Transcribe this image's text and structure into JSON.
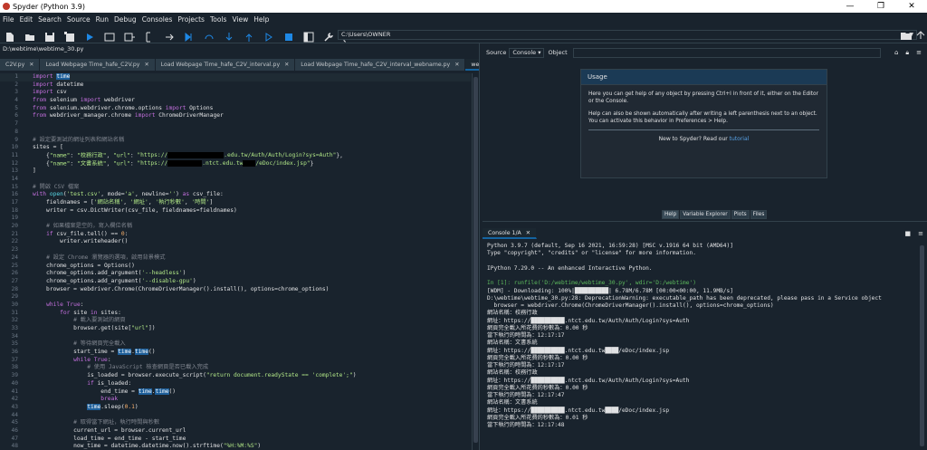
{
  "window": {
    "title": "Spyder (Python 3.9)",
    "controls": [
      "—",
      "❐",
      "✕"
    ]
  },
  "menu": [
    "File",
    "Edit",
    "Search",
    "Source",
    "Run",
    "Debug",
    "Consoles",
    "Projects",
    "Tools",
    "View",
    "Help"
  ],
  "toolbar": {
    "path": "C:\\Users\\OWNER"
  },
  "editor": {
    "filepath": "D:\\webtime\\webtime_30.py",
    "tabs": [
      {
        "label": "C2V.py",
        "active": false
      },
      {
        "label": "Load Webpage Time_hafe_C2V.py",
        "active": false
      },
      {
        "label": "Load Webpage Time_hafe_C2V_interval.py",
        "active": false
      },
      {
        "label": "Load Webpage Time_hafe_C2V_interval_webname.py",
        "active": false
      },
      {
        "label": "webtime_30.py",
        "active": true
      }
    ],
    "lines": [
      {
        "n": "1",
        "html": "<span class='k'>import</span> <span class='hl'>time</span>"
      },
      {
        "n": "2",
        "html": "<span class='k'>import</span> datetime"
      },
      {
        "n": "3",
        "html": "<span class='k'>import</span> csv"
      },
      {
        "n": "4",
        "html": "<span class='k'>from</span> selenium <span class='k'>import</span> webdriver"
      },
      {
        "n": "5",
        "html": "<span class='k'>from</span> selenium.webdriver.chrome.options <span class='k'>import</span> Options"
      },
      {
        "n": "6",
        "html": "<span class='k'>from</span> webdriver_manager.chrome <span class='k'>import</span> ChromeDriverManager"
      },
      {
        "n": "7",
        "html": ""
      },
      {
        "n": "8",
        "html": ""
      },
      {
        "n": "9",
        "html": "<span class='c'># 設定要測試的網址列表和網站名稱</span>"
      },
      {
        "n": "10",
        "html": "sites = ["
      },
      {
        "n": "11",
        "html": "    {<span class='s'>\"name\"</span>: <span class='s'>\"校務行政\"</span>, <span class='s'>\"url\"</span>: <span class='s'>\"https://<span class='redact' style='width:62px'></span>.edu.tw/Auth/Auth/Login?sys=Auth\"</span>},"
      },
      {
        "n": "12",
        "html": "    {<span class='s'>\"name\"</span>: <span class='s'>\"文書系統\"</span>, <span class='s'>\"url\"</span>: <span class='s'>\"https://<span class='redact' style='width:38px'></span>.ntct.edu.tw<span class='redact' style='width:14px'></span>/eDoc/index.jsp\"</span>}"
      },
      {
        "n": "13",
        "html": "]"
      },
      {
        "n": "14",
        "html": ""
      },
      {
        "n": "15",
        "html": "<span class='c'># 開啟 CSV 檔案</span>"
      },
      {
        "n": "16",
        "html": "<span class='k'>with</span> <span class='f'>open</span>(<span class='s'>'test.csv'</span>, mode=<span class='s'>'a'</span>, newline=<span class='s'>''</span>) <span class='k'>as</span> csv_file:"
      },
      {
        "n": "17",
        "html": "    fieldnames = [<span class='s'>'網站名稱'</span>, <span class='s'>'網址'</span>, <span class='s'>'執行秒數'</span>, <span class='s'>'時間'</span>]"
      },
      {
        "n": "18",
        "html": "    writer = csv.DictWriter(csv_file, fieldnames=fieldnames)"
      },
      {
        "n": "19",
        "html": ""
      },
      {
        "n": "20",
        "html": "    <span class='c'># 如果檔案是空的，寫入欄位名稱</span>"
      },
      {
        "n": "21",
        "html": "    <span class='k'>if</span> csv_file.tell() == <span class='o'>0</span>:"
      },
      {
        "n": "22",
        "html": "        writer.writeheader()"
      },
      {
        "n": "23",
        "html": ""
      },
      {
        "n": "24",
        "html": "    <span class='c'># 設定 Chrome 瀏覽器的選項，啟用背景模式</span>"
      },
      {
        "n": "25",
        "html": "    chrome_options = Options()"
      },
      {
        "n": "26",
        "html": "    chrome_options.add_argument(<span class='s'>'--headless'</span>)"
      },
      {
        "n": "27",
        "html": "    chrome_options.add_argument(<span class='s'>'--disable-gpu'</span>)"
      },
      {
        "n": "28",
        "html": "    browser = webdriver.Chrome(ChromeDriverManager().install(), options=chrome_options)"
      },
      {
        "n": "29",
        "html": ""
      },
      {
        "n": "30",
        "html": "    <span class='k'>while</span> <span class='k'>True</span>:"
      },
      {
        "n": "31",
        "html": "        <span class='k'>for</span> site <span class='k'>in</span> sites:"
      },
      {
        "n": "32",
        "html": "            <span class='c'># 載入要測試的網頁</span>"
      },
      {
        "n": "33",
        "html": "            browser.get(site[<span class='s'>\"url\"</span>])"
      },
      {
        "n": "34",
        "html": ""
      },
      {
        "n": "35",
        "html": "            <span class='c'># 等待網頁完全載入</span>"
      },
      {
        "n": "36",
        "html": "            start_time = <span class='hl'>time</span>.<span class='hl'>time</span>()"
      },
      {
        "n": "37",
        "html": "            <span class='k'>while</span> <span class='k'>True</span>:"
      },
      {
        "n": "38",
        "html": "                <span class='c'># 使用 JavaScript 檢查網頁是否已載入完成</span>"
      },
      {
        "n": "39",
        "html": "                is_loaded = browser.execute_script(<span class='s'>\"return document.readyState == 'complete';\"</span>)"
      },
      {
        "n": "40",
        "html": "                <span class='k'>if</span> is_loaded:"
      },
      {
        "n": "41",
        "html": "                    end_time = <span class='hl'>time</span>.<span class='hl'>time</span>()"
      },
      {
        "n": "42",
        "html": "                    <span class='k'>break</span>"
      },
      {
        "n": "43",
        "html": "                <span class='hl'>time</span>.sleep(<span class='o'>0.1</span>)"
      },
      {
        "n": "44",
        "html": ""
      },
      {
        "n": "45",
        "html": "            <span class='c'># 取得當下網址，執行時間與秒數</span>"
      },
      {
        "n": "46",
        "html": "            current_url = browser.current_url"
      },
      {
        "n": "47",
        "html": "            load_time = end_time - start_time"
      },
      {
        "n": "48",
        "html": "            now_time = datetime.datetime.now().strftime(<span class='s'>\"%H:%M:%S\"</span>)"
      }
    ]
  },
  "help": {
    "source_label": "Source",
    "source_value": "Console",
    "object_label": "Object",
    "card_title": "Usage",
    "p1": "Here you can get help of any object by pressing Ctrl+I in front of it, either on the Editor or the Console.",
    "p2": "Help can also be shown automatically after writing a left parenthesis next to an object. You can activate this behavior in Preferences > Help.",
    "new_to": "New to Spyder? Read our ",
    "tutorial": "tutorial",
    "tabs": [
      "Help",
      "Variable Explorer",
      "Plots",
      "Files"
    ]
  },
  "console": {
    "tab": "Console 1/A",
    "lines": [
      {
        "cls": "",
        "text": "Python 3.9.7 (default, Sep 16 2021, 16:59:28) [MSC v.1916 64 bit (AMD64)]"
      },
      {
        "cls": "",
        "text": "Type \"copyright\", \"credits\" or \"license\" for more information."
      },
      {
        "cls": "",
        "text": ""
      },
      {
        "cls": "",
        "text": "IPython 7.29.0 -- An enhanced Interactive Python."
      },
      {
        "cls": "",
        "text": ""
      },
      {
        "cls": "g",
        "text": "In [1]: runfile('D:/webtime/webtime_30.py', wdir='D:/webtime')"
      },
      {
        "cls": "",
        "text": "[WDM] - Downloading: 100%|██████████| 6.78M/6.78M [00:00<00:00, 11.9MB/s]"
      },
      {
        "cls": "",
        "text": "D:\\webtime\\webtime_30.py:28: DeprecationWarning: executable_path has been deprecated, please pass in a Service object"
      },
      {
        "cls": "",
        "text": "  browser = webdriver.Chrome(ChromeDriverManager().install(), options=chrome_options)"
      },
      {
        "cls": "",
        "text": "網站名稱：校務行政"
      },
      {
        "cls": "",
        "text": "網址：https://██████████.ntct.edu.tw/Auth/Auth/Login?sys=Auth"
      },
      {
        "cls": "",
        "text": "網頁完全載入所花費的秒數為：0.00 秒"
      },
      {
        "cls": "",
        "text": "當下執行的時間為：12:17:17"
      },
      {
        "cls": "",
        "text": "網站名稱：文書系統"
      },
      {
        "cls": "",
        "text": "網址：https://██████████.ntct.edu.tw████/eDoc/index.jsp"
      },
      {
        "cls": "",
        "text": "網頁完全載入所花費的秒數為：0.00 秒"
      },
      {
        "cls": "",
        "text": "當下執行的時間為：12:17:17"
      },
      {
        "cls": "",
        "text": "網站名稱：校務行政"
      },
      {
        "cls": "",
        "text": "網址：https://██████████.ntct.edu.tw/Auth/Auth/Login?sys=Auth"
      },
      {
        "cls": "",
        "text": "網頁完全載入所花費的秒數為：0.00 秒"
      },
      {
        "cls": "",
        "text": "當下執行的時間為：12:17:47"
      },
      {
        "cls": "",
        "text": "網站名稱：文書系統"
      },
      {
        "cls": "",
        "text": "網址：https://██████████.ntct.edu.tw████/eDoc/index.jsp"
      },
      {
        "cls": "",
        "text": "網頁完全載入所花費的秒數為：0.01 秒"
      },
      {
        "cls": "",
        "text": "當下執行的時間為：12:17:48"
      }
    ]
  },
  "colors": {
    "bg": "#19232d",
    "border": "#32414b",
    "accent": "#1464a0",
    "keyword": "#c670e0",
    "string": "#b0e686",
    "comment": "#7f848e"
  }
}
